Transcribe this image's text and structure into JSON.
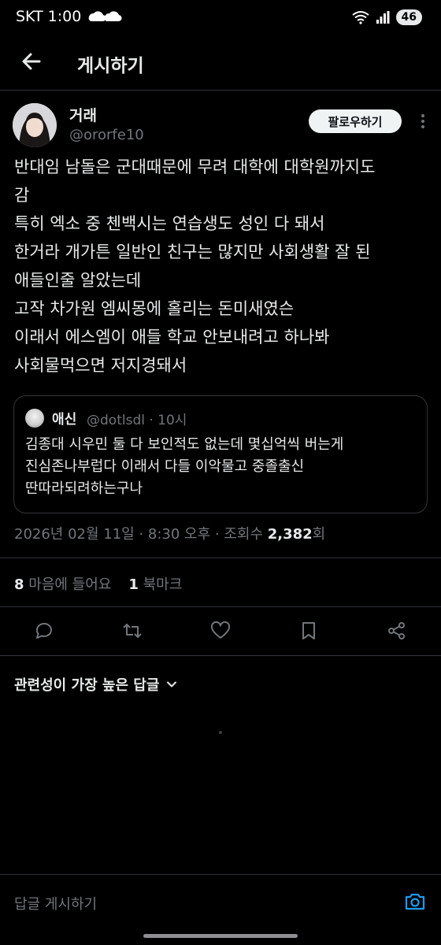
{
  "status_bar": {
    "carrier": "SKT",
    "time": "1:00",
    "battery": "46"
  },
  "header": {
    "title": "게시하기"
  },
  "tweet": {
    "author_name": "거래",
    "handle": "@ororfe10",
    "follow_label": "팔로우하기",
    "text_lines": [
      "반대임 남돌은 군대때문에 무려 대학에 대학원까지도",
      "감",
      "특히 엑소 중 첸백시는 연습생도 성인 다 돼서",
      "한거라 개가튼 일반인 친구는 많지만 사회생활 잘 된",
      "애들인줄 알았는데",
      "고작 차가원 엠씨몽에 홀리는 돈미새였슨",
      "이래서 에스엠이 애들 학교 안보내려고 하나봐",
      "사회물먹으면 저지경돼서"
    ],
    "timestamp": "2026년 02월 11일 · 8:30 오후 · 조회수 ",
    "views": "2,382",
    "views_suffix": "회",
    "likes_count": "8",
    "likes_label": "마음에 들어요",
    "bookmarks_count": "1",
    "bookmarks_label": "북마크"
  },
  "quote": {
    "name": "애신",
    "meta": "@dotlsdl · 10시",
    "text_lines": [
      "김종대 시우민 둘 다 보인적도 없는데 몇십억씩 버는게",
      "진심존나부럽다 이래서 다들 이악물고 중졸출신",
      "딴따라되려하는구나"
    ]
  },
  "replies": {
    "sort_label": "관련성이 가장 높은 답글"
  },
  "reply_bar": {
    "placeholder": "답글 게시하기"
  },
  "colors": {
    "accent": "#1d9bf0",
    "muted": "#71767b",
    "text": "#e7e9ea",
    "border": "#2f3336"
  }
}
